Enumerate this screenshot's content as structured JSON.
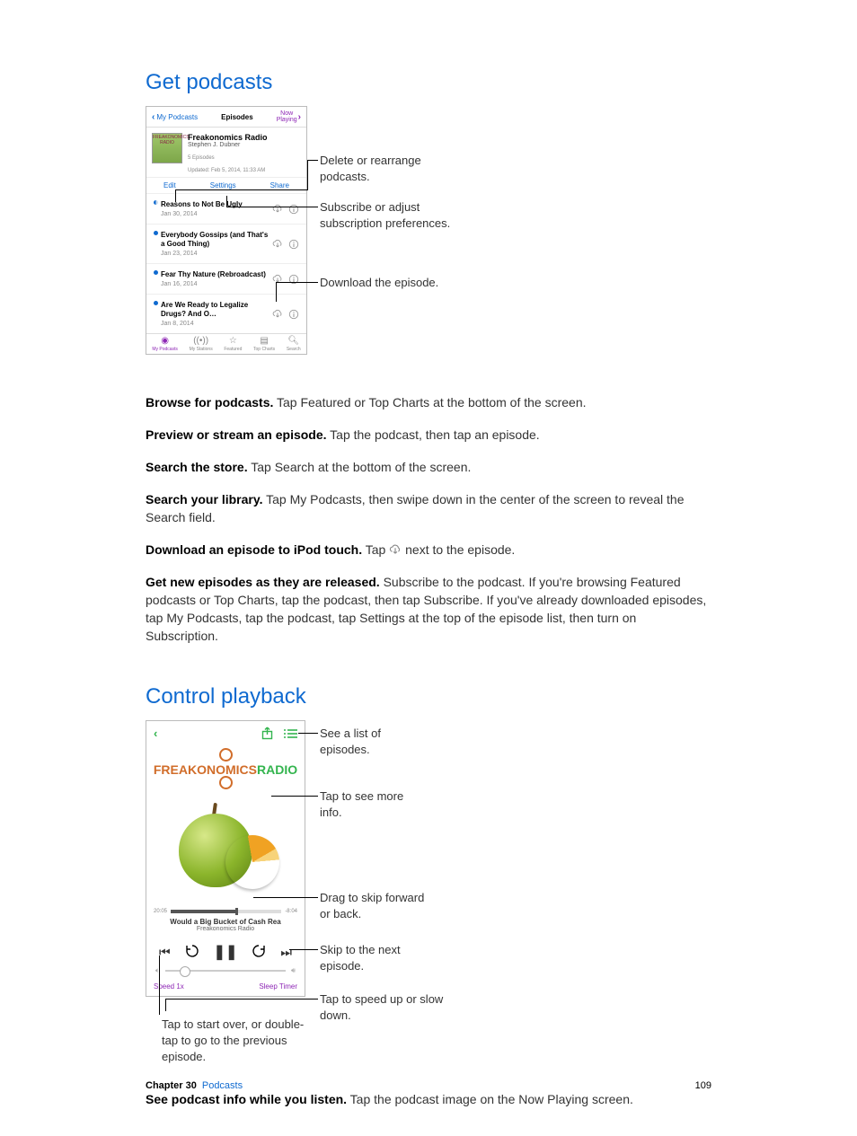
{
  "headings": {
    "get_podcasts": "Get podcasts",
    "control_playback": "Control playback"
  },
  "fig1": {
    "back_label": "My Podcasts",
    "title": "Episodes",
    "now_playing": "Now\nPlaying",
    "podcast_title": "Freakonomics Radio",
    "podcast_author": "Stephen J. Dubner",
    "episodes_count": "5 Episodes",
    "updated": "Updated: Feb 5, 2014, 11:33 AM",
    "bar": {
      "edit": "Edit",
      "settings": "Settings",
      "share": "Share"
    },
    "episodes": [
      {
        "title": "Reasons to Not Be Ugly",
        "date": "Jan 30, 2014"
      },
      {
        "title": "Everybody Gossips (and That's a Good Thing)",
        "date": "Jan 23, 2014"
      },
      {
        "title": "Fear Thy Nature (Rebroadcast)",
        "date": "Jan 16, 2014"
      },
      {
        "title": "Are We Ready to Legalize Drugs? And O…",
        "date": "Jan 8, 2014"
      }
    ],
    "tabs": {
      "my": "My Podcasts",
      "stations": "My Stations",
      "featured": "Featured",
      "top": "Top Charts",
      "search": "Search"
    },
    "callouts": {
      "delete": "Delete or rearrange podcasts.",
      "subscribe": "Subscribe or adjust subscription preferences.",
      "download": "Download the episode."
    }
  },
  "body1": {
    "p1b": "Browse for podcasts.",
    "p1": " Tap Featured or Top Charts at the bottom of the screen.",
    "p2b": "Preview or stream an episode.",
    "p2": " Tap the podcast, then tap an episode.",
    "p3b": "Search the store.",
    "p3": " Tap Search at the bottom of the screen.",
    "p4b": "Search your library.",
    "p4": " Tap My Podcasts, then swipe down in the center of the screen to reveal the Search field.",
    "p5b": "Download an episode to iPod touch.",
    "p5a": " Tap ",
    "p5c": " next to the episode.",
    "p6b": "Get new episodes as they are released.",
    "p6": " Subscribe to the podcast. If you're browsing Featured podcasts or Top Charts, tap the podcast, then tap Subscribe. If you've already downloaded episodes, tap My Podcasts, tap the podcast, tap Settings at the top of the episode list, then turn on Subscription."
  },
  "fig2": {
    "logo_a": "FREAKONOMICS",
    "logo_b": "RADIO",
    "elapsed": "20:05",
    "remaining": "-8:04",
    "np_title": "Would a Big Bucket of Cash Rea",
    "np_sub": "Freakonomics Radio",
    "speed": "Speed 1x",
    "sleep": "Sleep Timer",
    "callouts": {
      "list": "See a list of episodes.",
      "info": "Tap to see more info.",
      "drag": "Drag to skip forward or back.",
      "skip": "Skip to the next episode.",
      "speed": "Tap to speed up or slow down.",
      "start": "Tap to start over, or double-tap to go to the previous episode."
    }
  },
  "body2": {
    "p1b": "See podcast info while you listen.",
    "p1": " Tap the podcast image on the Now Playing screen."
  },
  "footer": {
    "chapter": "Chapter  30",
    "name": "Podcasts",
    "page": "109"
  }
}
